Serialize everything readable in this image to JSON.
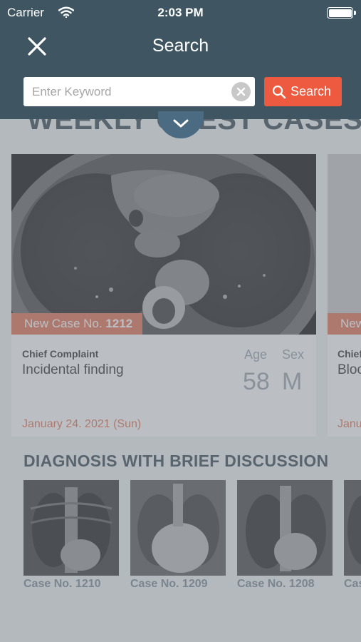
{
  "status_bar": {
    "carrier": "Carrier",
    "time": "2:03 PM"
  },
  "header": {
    "title": "Search"
  },
  "search": {
    "placeholder": "Enter Keyword",
    "value": "",
    "button_label": "Search"
  },
  "weekly_section": {
    "title": "WEEKLY CHEST CASES"
  },
  "case_cards": [
    {
      "badge_prefix": "New Case No.",
      "case_number": "1212",
      "chief_complaint_label": "Chief Complaint",
      "chief_complaint": "Incidental finding",
      "age_label": "Age",
      "age": "58",
      "sex_label": "Sex",
      "sex": "M",
      "date": "January 24. 2021 (Sun)"
    },
    {
      "badge_prefix": "New Case No.",
      "chief_complaint_label": "Chief Complaint",
      "chief_complaint": "Blood",
      "date": "January"
    }
  ],
  "diagnosis_section": {
    "title": "DIAGNOSIS WITH BRIEF DISCUSSION",
    "items": [
      {
        "label": "Case No. 1210"
      },
      {
        "label": "Case No. 1209"
      },
      {
        "label": "Case No. 1208"
      },
      {
        "label": "Case No."
      }
    ]
  },
  "colors": {
    "header_bg": "#3f5662",
    "accent": "#ee5a3f",
    "badge": "#e37355",
    "heading": "#3a4a55"
  },
  "icons": [
    "wifi-icon",
    "battery-icon",
    "close-icon",
    "clear-icon",
    "search-icon",
    "chevron-down-icon"
  ]
}
